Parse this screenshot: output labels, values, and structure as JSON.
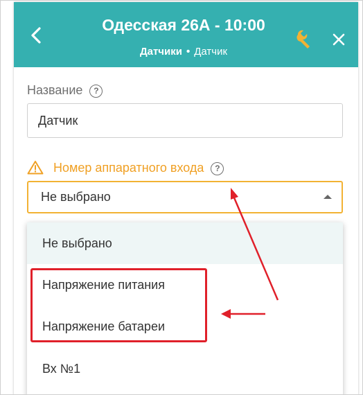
{
  "header": {
    "title": "Одесская 26А - 10:00",
    "breadcrumb_parent": "Датчики",
    "breadcrumb_separator": "•",
    "breadcrumb_current": "Датчик",
    "background_color": "#35b0b0"
  },
  "form": {
    "name_label": "Название",
    "name_value": "Датчик",
    "input_number_label": "Номер аппаратного входа",
    "input_number_value": "Не выбрано",
    "help_glyph": "?",
    "warning_color": "#f0a024"
  },
  "dropdown": {
    "options": [
      "Не выбрано",
      "Напряжение питания",
      "Напряжение батареи",
      "Вх №1"
    ]
  },
  "annotation": {
    "color": "#e0202a"
  }
}
